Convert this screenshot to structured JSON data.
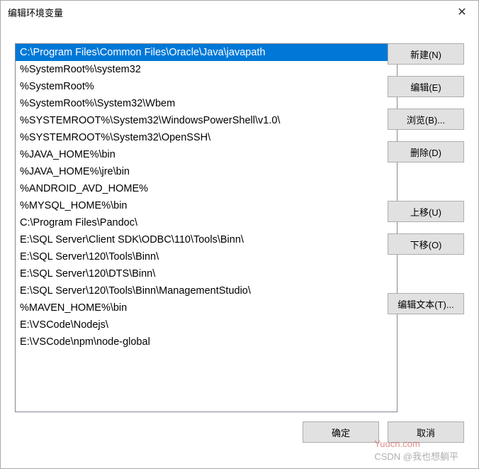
{
  "window": {
    "title": "编辑环境变量"
  },
  "list": {
    "items": [
      "C:\\Program Files\\Common Files\\Oracle\\Java\\javapath",
      "%SystemRoot%\\system32",
      "%SystemRoot%",
      "%SystemRoot%\\System32\\Wbem",
      "%SYSTEMROOT%\\System32\\WindowsPowerShell\\v1.0\\",
      "%SYSTEMROOT%\\System32\\OpenSSH\\",
      "%JAVA_HOME%\\bin",
      "%JAVA_HOME%\\jre\\bin",
      "%ANDROID_AVD_HOME%",
      "%MYSQL_HOME%\\bin",
      "C:\\Program Files\\Pandoc\\",
      "E:\\SQL Server\\Client SDK\\ODBC\\110\\Tools\\Binn\\",
      "E:\\SQL Server\\120\\Tools\\Binn\\",
      "E:\\SQL Server\\120\\DTS\\Binn\\",
      "E:\\SQL Server\\120\\Tools\\Binn\\ManagementStudio\\",
      "%MAVEN_HOME%\\bin",
      "E:\\VSCode\\Nodejs\\",
      "E:\\VSCode\\npm\\node-global"
    ],
    "selected_index": 0
  },
  "buttons": {
    "new": "新建(N)",
    "edit": "编辑(E)",
    "browse": "浏览(B)...",
    "delete": "删除(D)",
    "move_up": "上移(U)",
    "move_down": "下移(O)",
    "edit_text": "编辑文本(T)...",
    "ok": "确定",
    "cancel": "取消"
  },
  "watermark": {
    "brand": "Yuucn.com",
    "text": "CSDN @我也想躺平"
  }
}
